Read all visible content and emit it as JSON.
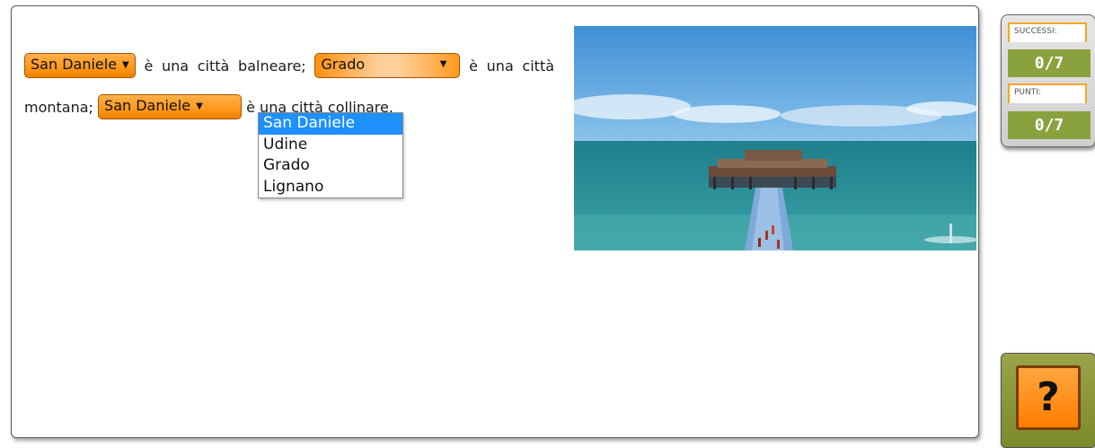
{
  "exercise": {
    "select1": {
      "value": "San Daniele",
      "caret": "▼"
    },
    "text1": "è una città balneare;",
    "select2": {
      "value": "Grado",
      "caret": "▼"
    },
    "text2a": "è",
    "text2b": "una città montana;",
    "select3": {
      "value": "San Daniele",
      "caret": "▼"
    },
    "text3": "è una città",
    "text4": "collinare.",
    "dropdown_options": [
      "San Daniele",
      "Udine",
      "Grado",
      "Lignano"
    ],
    "dropdown_selected": "San Daniele"
  },
  "photo": {
    "subject": "pier into the sea"
  },
  "score": {
    "successi_label": "SUCCESSI:",
    "successi_value": "0/7",
    "punti_label": "PUNTI:",
    "punti_value": "0/7"
  },
  "help": {
    "label": "?"
  },
  "colors": {
    "select_orange": "#ff9a1e",
    "score_green": "#8aa23e",
    "highlight_blue": "#1e90ff"
  }
}
